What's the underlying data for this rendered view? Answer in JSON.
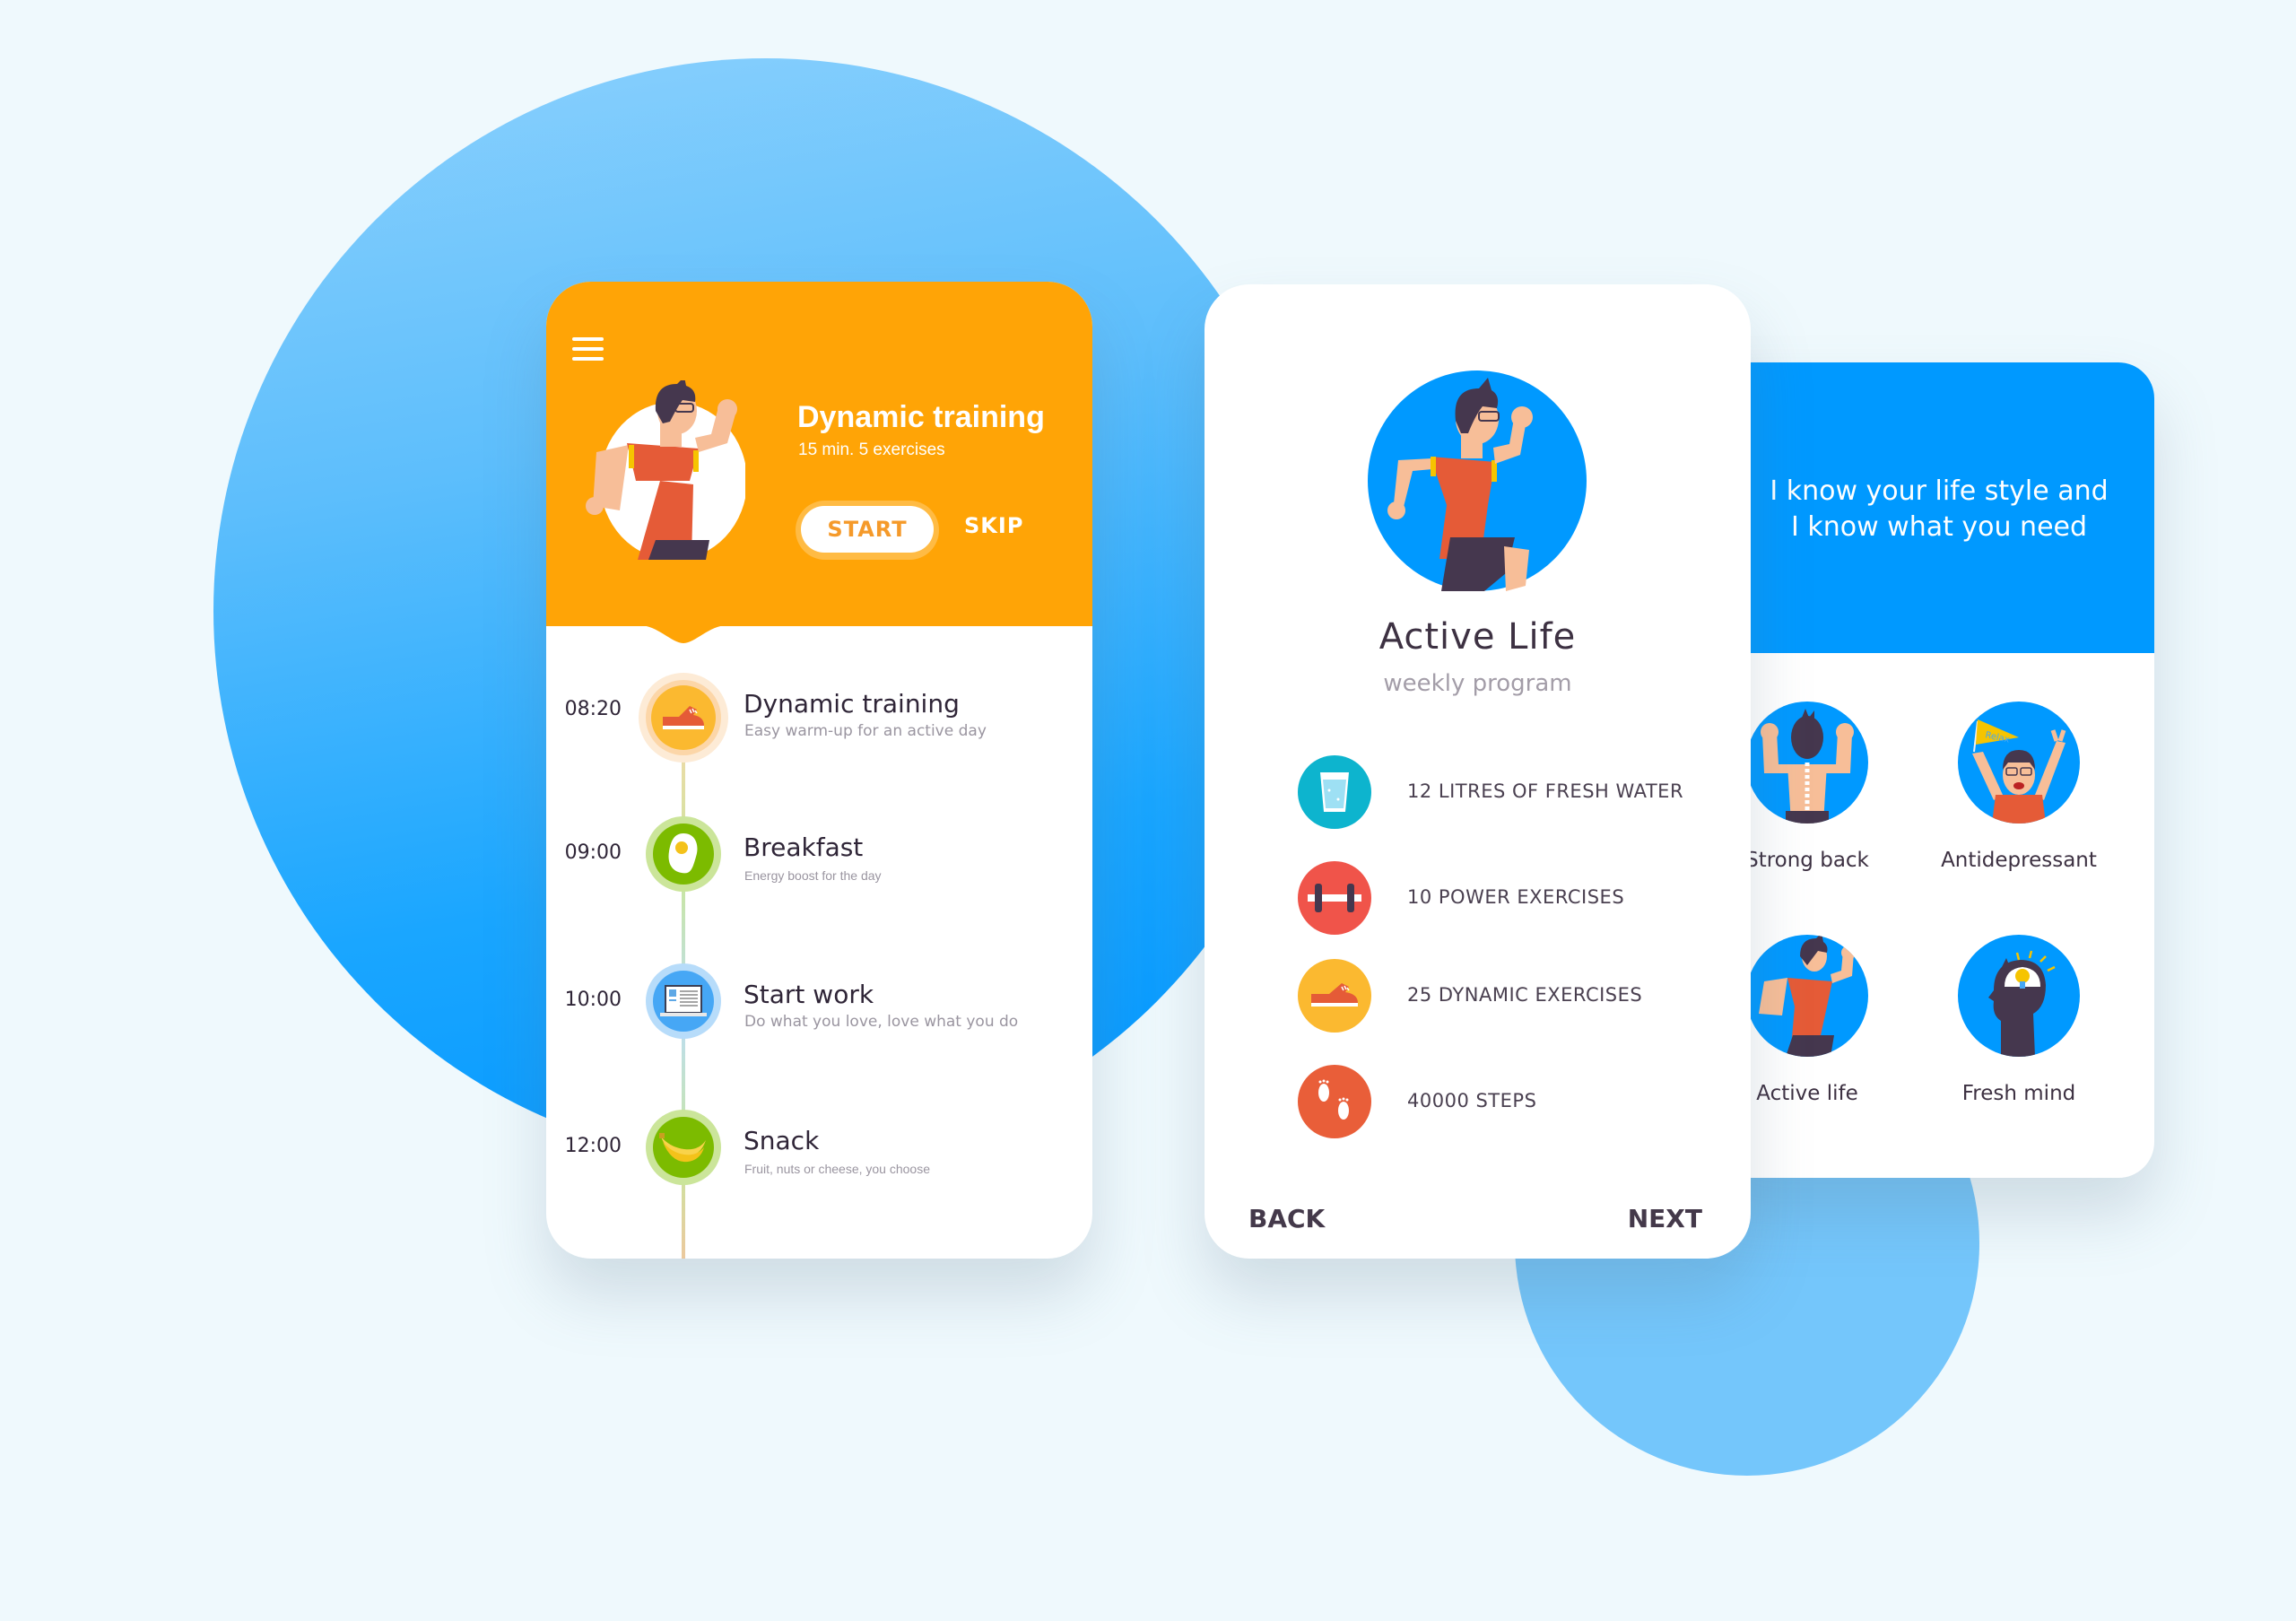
{
  "colors": {
    "background": "#EFF9FD",
    "orange_header": "#FFA406",
    "blue_header": "#0099FF",
    "text_dark": "#2F2537",
    "text_muted": "#9A95A0"
  },
  "daily_plan_screen": {
    "menu_icon": "hamburger-menu-icon",
    "header": {
      "title": "Dynamic training",
      "subtitle": "15 min. 5 exercises",
      "start_label": "START",
      "skip_label": "SKIP"
    },
    "timeline": [
      {
        "time": "08:20",
        "title": "Dynamic training",
        "description": "Easy warm-up for an active day",
        "icon": "sneaker-icon",
        "color": "#FBB930",
        "ring": "#FCDDB8"
      },
      {
        "time": "09:00",
        "title": "Breakfast",
        "description": "Energy boost for the day",
        "icon": "fried-egg-icon",
        "color": "#7CBB00",
        "ring": "#CBE59A"
      },
      {
        "time": "10:00",
        "title": "Start work",
        "description": "Do what you love, love what you do",
        "icon": "laptop-icon",
        "color": "#46A7F5",
        "ring": "#B7DCFA"
      },
      {
        "time": "12:00",
        "title": "Snack",
        "description": "Fruit, nuts or cheese, you choose",
        "icon": "banana-icon",
        "color": "#7CBB00",
        "ring": "#CBE59A"
      }
    ]
  },
  "program_screen": {
    "title": "Active Life",
    "subtitle": "weekly program",
    "items": [
      {
        "label": "12 LITRES OF FRESH WATER",
        "icon": "water-glass-icon",
        "color": "#0DB4CE"
      },
      {
        "label": "10 POWER EXERCISES",
        "icon": "dumbbell-icon",
        "color": "#F0544A"
      },
      {
        "label": "25 DYNAMIC EXERCISES",
        "icon": "sneaker-icon",
        "color": "#FBB930"
      },
      {
        "label": "40000 STEPS",
        "icon": "footprints-icon",
        "color": "#E95E39"
      }
    ],
    "back_label": "BACK",
    "next_label": "NEXT"
  },
  "benefits_screen": {
    "quote_line1": "I know your life style and",
    "quote_line2": "I know what you need",
    "benefits": [
      {
        "label": "Strong back",
        "icon": "strong-back-icon"
      },
      {
        "label": "Antidepressant",
        "icon": "relax-flag-icon",
        "flag_text": "Relax"
      },
      {
        "label": "Active life",
        "icon": "running-man-icon"
      },
      {
        "label": "Fresh mind",
        "icon": "lightbulb-head-icon"
      }
    ]
  }
}
